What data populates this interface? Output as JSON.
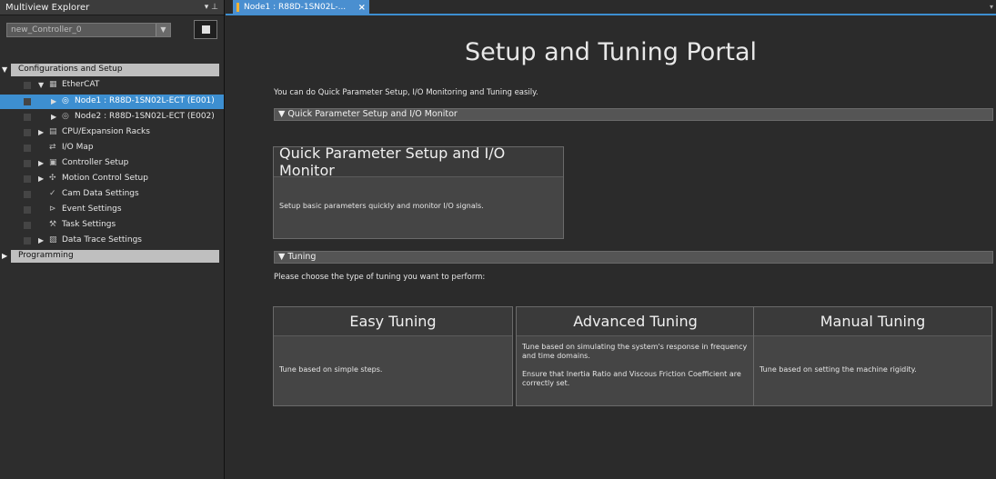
{
  "explorer": {
    "title": "Multiview Explorer",
    "pin_glyph": "▾ ⊥",
    "controller": "new_Controller_0",
    "dropdown_glyph": "▼",
    "tree": [
      {
        "label": "Configurations and Setup",
        "arrow": "▼",
        "icon": "",
        "kind": "header"
      },
      {
        "label": "EtherCAT",
        "arrow": "▼",
        "icon": "▦",
        "kind": "group"
      },
      {
        "label": "Node1 : R88D-1SN02L-ECT (E001)",
        "arrow": "▶",
        "icon": "◎",
        "kind": "selected"
      },
      {
        "label": "Node2 : R88D-1SN02L-ECT (E002)",
        "arrow": "▶",
        "icon": "◎",
        "kind": "node"
      },
      {
        "label": "CPU/Expansion Racks",
        "arrow": "▶",
        "icon": "▤",
        "kind": "item"
      },
      {
        "label": "I/O Map",
        "arrow": "",
        "icon": "⇄",
        "kind": "leaf"
      },
      {
        "label": "Controller Setup",
        "arrow": "▶",
        "icon": "▣",
        "kind": "item"
      },
      {
        "label": "Motion Control Setup",
        "arrow": "▶",
        "icon": "✣",
        "kind": "item"
      },
      {
        "label": "Cam Data Settings",
        "arrow": "",
        "icon": "✓",
        "kind": "leaf"
      },
      {
        "label": "Event Settings",
        "arrow": "",
        "icon": "⊳",
        "kind": "leaf"
      },
      {
        "label": "Task Settings",
        "arrow": "",
        "icon": "⚒",
        "kind": "leaf"
      },
      {
        "label": "Data Trace Settings",
        "arrow": "▶",
        "icon": "▨",
        "kind": "item"
      },
      {
        "label": "Programming",
        "arrow": "▶",
        "icon": "",
        "kind": "header"
      }
    ]
  },
  "tab": {
    "label": "Node1 : R88D-1SN02L-...",
    "close": "×",
    "menu_glyph": "▾"
  },
  "portal": {
    "title": "Setup and Tuning Portal",
    "intro": "You can do Quick Parameter Setup, I/O Monitoring and Tuning easily.",
    "quick_section": "▼ Quick Parameter Setup and I/O Monitor",
    "quick_card": {
      "title": "Quick Parameter Setup and I/O Monitor",
      "desc": "Setup basic parameters quickly and monitor I/O signals."
    },
    "tuning_section": "▼ Tuning",
    "tuning_intro": "Please choose the type of tuning you want to perform:",
    "easy": {
      "title": "Easy Tuning",
      "desc": "Tune based on simple steps."
    },
    "advanced": {
      "title": "Advanced Tuning",
      "desc1": "Tune based on simulating the system's response in frequency and time domains.",
      "desc2": "Ensure that Inertia Ratio and Viscous Friction Coefficient are correctly set."
    },
    "manual": {
      "title": "Manual Tuning",
      "desc": "Tune based on setting the machine rigidity."
    }
  }
}
